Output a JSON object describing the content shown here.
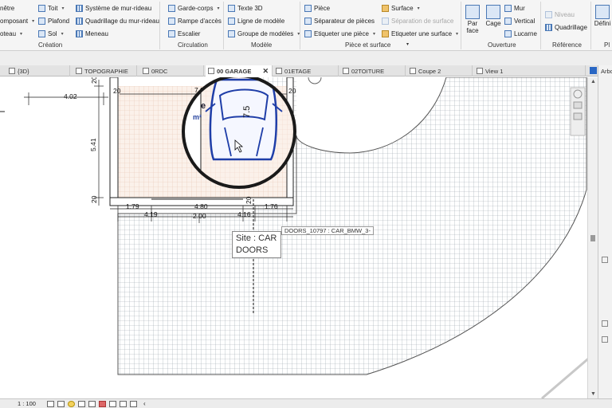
{
  "ribbon": {
    "col0": [
      "nêtre",
      "omposant",
      "oteau"
    ],
    "col1": [
      "Toit",
      "Plafond",
      "Sol"
    ],
    "col2": [
      "Système de mur-rideau",
      "Quadrillage du mur-rideau",
      "Meneau"
    ],
    "col3": [
      "Garde-corps",
      "Rampe d'accès",
      "Escalier"
    ],
    "col4": [
      "Texte 3D",
      "Ligne de modèle",
      "Groupe de modèles"
    ],
    "col5": [
      "Pièce",
      "Séparateur de pièces",
      "Etiqueter une pièce"
    ],
    "col6": [
      "Surface",
      "Séparation de surface",
      "Etiqueter une surface"
    ],
    "par_face": "Par face",
    "cage": "Cage",
    "col7": [
      "Mur",
      "Vertical",
      "Lucarne"
    ],
    "niveau": "Niveau",
    "quadrillage": "Quadrillage",
    "defini": "Défini",
    "groups": {
      "creation": "Création",
      "circulation": "Circulation",
      "modele": "Modèle",
      "piece_surface": "Pièce et surface",
      "ouverture": "Ouverture",
      "reference": "Référence",
      "pl": "Pl"
    }
  },
  "tabs": [
    {
      "label": "{3D}"
    },
    {
      "label": "TOPOGRAPHIE"
    },
    {
      "label": "0RDC"
    },
    {
      "label": "00 GARAGE",
      "close": "✕"
    },
    {
      "label": "01ETAGE"
    },
    {
      "label": "02TOITURE"
    },
    {
      "label": "Coupe 2"
    },
    {
      "label": "View 1"
    }
  ],
  "right_panel_label": "Arbo",
  "dimensions": {
    "d402": "4.02",
    "d795": "7.95",
    "d541": "5.41",
    "d20a": "20",
    "d20b": "20",
    "d20c": "20",
    "d20d": "20",
    "d20e": "20",
    "d179": "1.79",
    "d480": "4.80",
    "d176": "1.76",
    "d419": "4.19",
    "d200": "2.00",
    "d416": "4.16",
    "d75": "7.5"
  },
  "room_label_partial": "e",
  "room_area_unit": "m²",
  "tooltip": {
    "line1": "Site : CAR",
    "line2": "DOORS",
    "ext": "DOORS_10797 : CAR_BMW_3-"
  },
  "status": {
    "scale": "1 : 100"
  }
}
